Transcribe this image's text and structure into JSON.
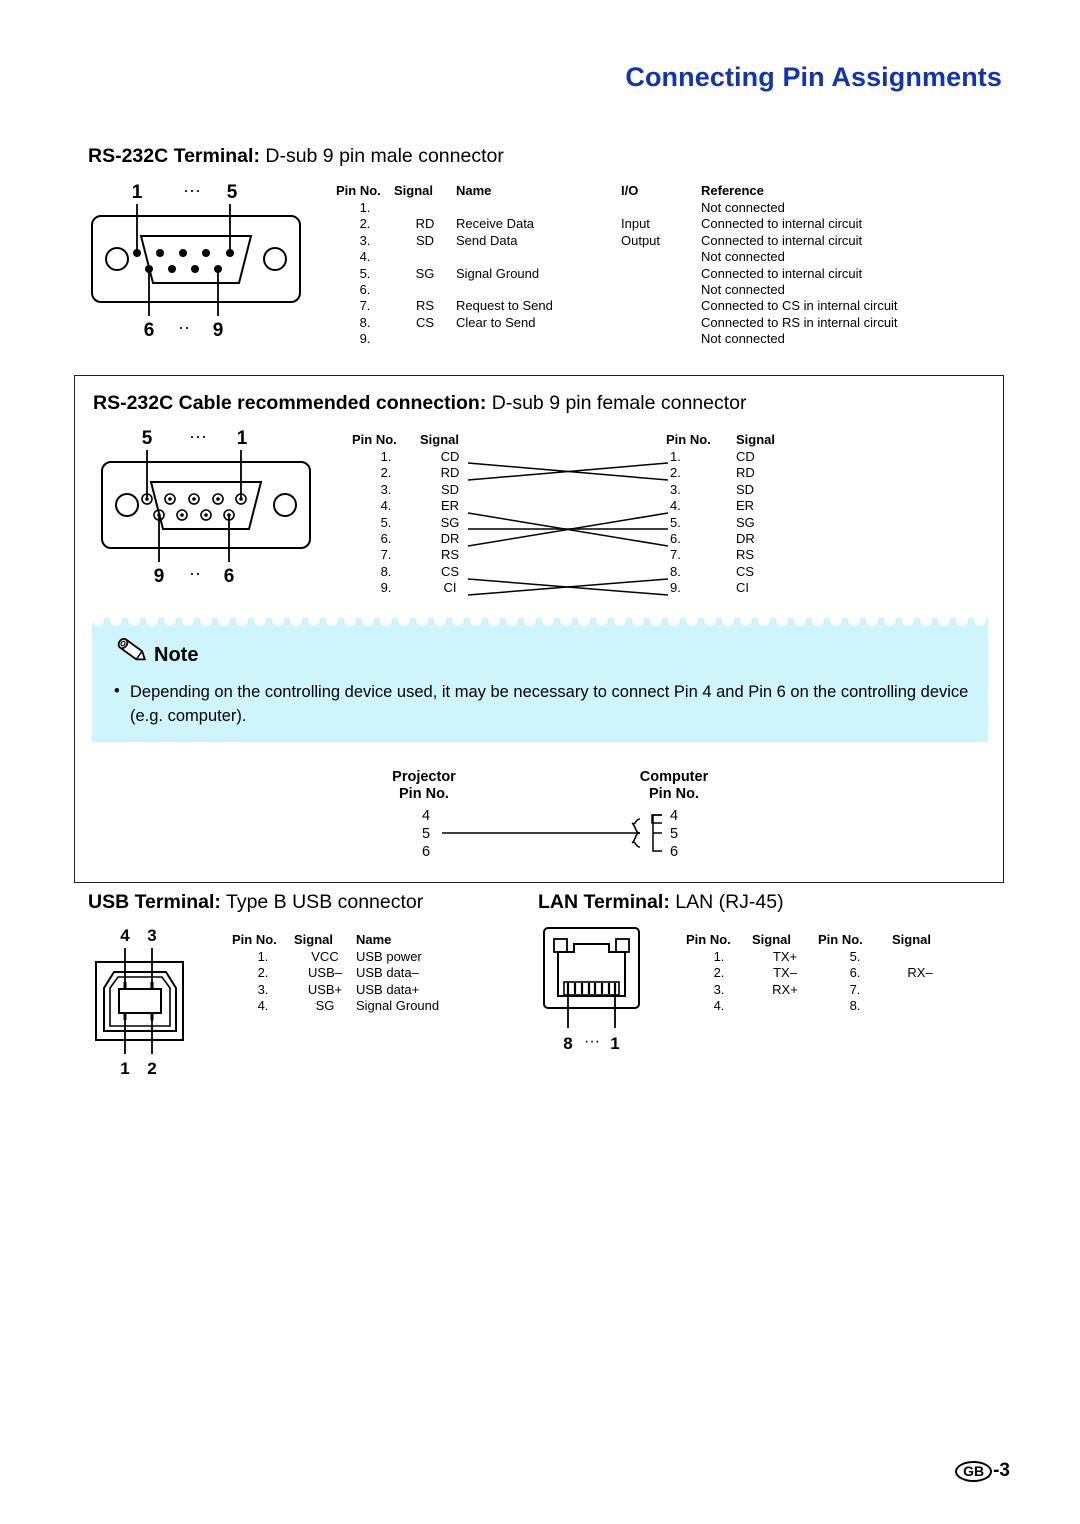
{
  "page": {
    "title": "Connecting Pin Assignments",
    "footer_locale": "GB",
    "footer_page": "-3",
    "title_color": "#1134b4",
    "note_bg_color": "#cdf5fb"
  },
  "rs232c_terminal": {
    "heading_bold": "RS-232C Terminal:",
    "heading_rest": " D-sub 9 pin male connector",
    "connector": {
      "top_left_label": "1",
      "top_dots": "···",
      "top_right_label": "5",
      "bottom_left_label": "6",
      "bottom_dots": "··",
      "bottom_right_label": "9"
    },
    "columns": [
      "Pin No.",
      "Signal",
      "Name",
      "I/O",
      "Reference"
    ],
    "rows": [
      {
        "pin": "1.",
        "signal": "",
        "name": "",
        "io": "",
        "reference": "Not connected"
      },
      {
        "pin": "2.",
        "signal": "RD",
        "name": "Receive Data",
        "io": "Input",
        "reference": "Connected to internal circuit"
      },
      {
        "pin": "3.",
        "signal": "SD",
        "name": "Send Data",
        "io": "Output",
        "reference": "Connected to internal circuit"
      },
      {
        "pin": "4.",
        "signal": "",
        "name": "",
        "io": "",
        "reference": "Not connected"
      },
      {
        "pin": "5.",
        "signal": "SG",
        "name": "Signal Ground",
        "io": "",
        "reference": "Connected to internal circuit"
      },
      {
        "pin": "6.",
        "signal": "",
        "name": "",
        "io": "",
        "reference": "Not connected"
      },
      {
        "pin": "7.",
        "signal": "RS",
        "name": "Request to Send",
        "io": "",
        "reference": "Connected to CS in internal circuit"
      },
      {
        "pin": "8.",
        "signal": "CS",
        "name": "Clear to Send",
        "io": "",
        "reference": "Connected to RS in internal circuit"
      },
      {
        "pin": "9.",
        "signal": "",
        "name": "",
        "io": "",
        "reference": "Not connected"
      }
    ]
  },
  "rs232c_cable": {
    "heading_bold": "RS-232C Cable recommended connection:",
    "heading_rest": " D-sub 9 pin female connector",
    "connector": {
      "top_left_label": "5",
      "top_dots": "···",
      "top_right_label": "1",
      "bottom_left_label": "9",
      "bottom_dots": "··",
      "bottom_right_label": "6"
    },
    "columns_left": [
      "Pin No.",
      "Signal"
    ],
    "columns_right": [
      "Pin No.",
      "Signal"
    ],
    "rows_left": [
      {
        "pin": "1.",
        "signal": "CD"
      },
      {
        "pin": "2.",
        "signal": "RD"
      },
      {
        "pin": "3.",
        "signal": "SD"
      },
      {
        "pin": "4.",
        "signal": "ER"
      },
      {
        "pin": "5.",
        "signal": "SG"
      },
      {
        "pin": "6.",
        "signal": "DR"
      },
      {
        "pin": "7.",
        "signal": "RS"
      },
      {
        "pin": "8.",
        "signal": "CS"
      },
      {
        "pin": "9.",
        "signal": "CI"
      }
    ],
    "rows_right": [
      {
        "pin": "1.",
        "signal": "CD"
      },
      {
        "pin": "2.",
        "signal": "RD"
      },
      {
        "pin": "3.",
        "signal": "SD"
      },
      {
        "pin": "4.",
        "signal": "ER"
      },
      {
        "pin": "5.",
        "signal": "SG"
      },
      {
        "pin": "6.",
        "signal": "DR"
      },
      {
        "pin": "7.",
        "signal": "RS"
      },
      {
        "pin": "8.",
        "signal": "CS"
      },
      {
        "pin": "9.",
        "signal": "CI"
      }
    ],
    "wiring": [
      {
        "from": 2,
        "to": 3
      },
      {
        "from": 3,
        "to": 2
      },
      {
        "from": 4,
        "to": 6
      },
      {
        "from": 5,
        "to": 5
      },
      {
        "from": 6,
        "to": 4
      },
      {
        "from": 7,
        "to": 8
      },
      {
        "from": 8,
        "to": 7
      }
    ]
  },
  "note": {
    "title": "Note",
    "bullet": "•",
    "text": "Depending on the controlling device used, it may be necessary to connect Pin 4 and Pin 6 on the controlling device (e.g. computer)."
  },
  "pin456_diagram": {
    "left_title_line1": "Projector",
    "left_title_line2": "Pin No.",
    "right_title_line1": "Computer",
    "right_title_line2": "Pin No.",
    "left_pins": [
      "4",
      "5",
      "6"
    ],
    "right_pins": [
      "4",
      "5",
      "6"
    ]
  },
  "usb_terminal": {
    "heading_bold": "USB Terminal:",
    "heading_rest": " Type B USB connector",
    "connector": {
      "top_left_label": "4",
      "top_right_label": "3",
      "bottom_left_label": "1",
      "bottom_right_label": "2"
    },
    "columns": [
      "Pin No.",
      "Signal",
      "Name"
    ],
    "rows": [
      {
        "pin": "1.",
        "signal": "VCC",
        "name": "USB power"
      },
      {
        "pin": "2.",
        "signal": "USB–",
        "name": "USB data–"
      },
      {
        "pin": "3.",
        "signal": "USB+",
        "name": "USB data+"
      },
      {
        "pin": "4.",
        "signal": "SG",
        "name": "Signal Ground"
      }
    ]
  },
  "lan_terminal": {
    "heading_bold": "LAN Terminal:",
    "heading_rest": " LAN (RJ-45)",
    "connector": {
      "left_label": "8",
      "dots": "···",
      "right_label": "1"
    },
    "columns": [
      "Pin No.",
      "Signal",
      "Pin No.",
      "Signal"
    ],
    "rows": [
      {
        "pin_l": "1.",
        "sig_l": "TX+",
        "pin_r": "5.",
        "sig_r": ""
      },
      {
        "pin_l": "2.",
        "sig_l": "TX–",
        "pin_r": "6.",
        "sig_r": "RX–"
      },
      {
        "pin_l": "3.",
        "sig_l": "RX+",
        "pin_r": "7.",
        "sig_r": ""
      },
      {
        "pin_l": "4.",
        "sig_l": "",
        "pin_r": "8.",
        "sig_r": ""
      }
    ]
  }
}
